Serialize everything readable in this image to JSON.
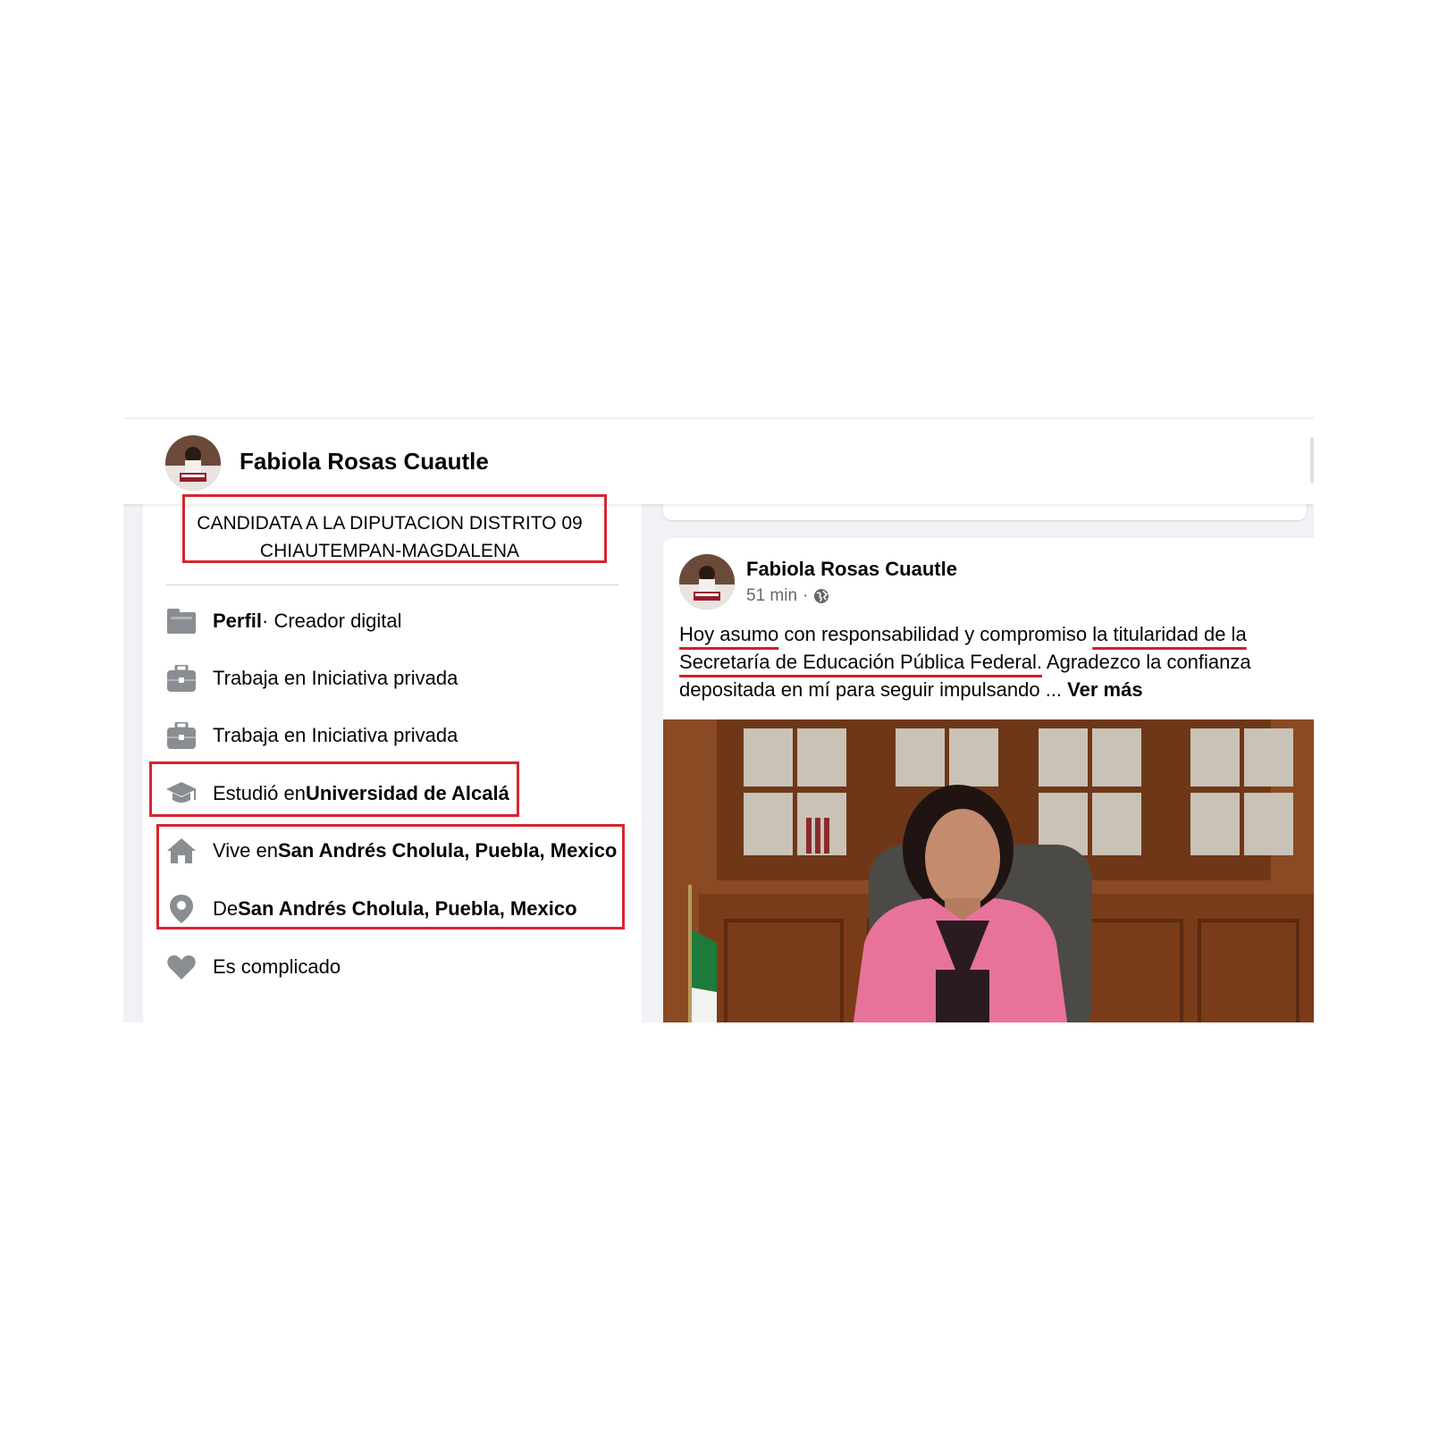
{
  "header": {
    "profile_name": "Fabiola Rosas Cuautle"
  },
  "intro": {
    "bio_line1": "CANDIDATA A LA DIPUTACION DISTRITO 09",
    "bio_line2": "CHIAUTEMPAN-MAGDALENA",
    "items": [
      {
        "icon": "flag-icon",
        "bold": "Perfil",
        "text": " · Creador digital"
      },
      {
        "icon": "briefcase-icon",
        "text": "Trabaja en Iniciativa privada"
      },
      {
        "icon": "briefcase-icon",
        "text": "Trabaja en Iniciativa privada"
      },
      {
        "icon": "graduation-cap-icon",
        "text": "Estudió en ",
        "bold": "Universidad de Alcalá"
      },
      {
        "icon": "home-icon",
        "text": "Vive en ",
        "bold": "San Andrés Cholula, Puebla, Mexico"
      },
      {
        "icon": "location-pin-icon",
        "text": "De ",
        "bold": "San Andrés Cholula, Puebla, Mexico"
      },
      {
        "icon": "heart-icon",
        "text": "Es complicado"
      }
    ]
  },
  "post": {
    "author": "Fabiola Rosas Cuautle",
    "time": "51 min",
    "separator": "·",
    "privacy_icon": "globe-icon",
    "text": {
      "u1": "Hoy asumo",
      "t1": " con responsabilidad y compromiso ",
      "u2": "la titularidad de la Secretaría de Educación Pública Federal.",
      "t2": " Agradezco la confianza depositada en mí para seguir impulsando ... ",
      "more": "Ver más"
    }
  },
  "colors": {
    "annotation_red": "#d7262e",
    "icon_gray": "#8a8d91",
    "page_bg": "#f0f2f5"
  }
}
